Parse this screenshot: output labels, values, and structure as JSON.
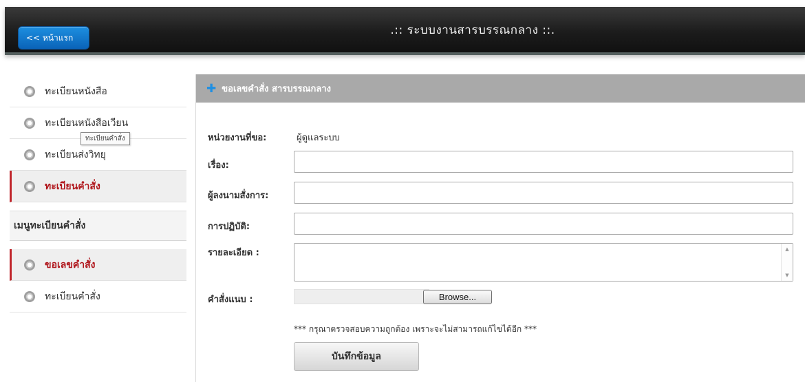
{
  "header": {
    "home_label": "<< หน้าแรก",
    "title": ".:: ระบบงานสารบรรณกลาง ::."
  },
  "sidebar": {
    "top_items": [
      {
        "label": "ทะเบียนหนังสือ",
        "active": false
      },
      {
        "label": "ทะเบียนหนังสือเวียน",
        "active": false
      },
      {
        "label": "ทะเบียนส่งวิทยุ",
        "active": false
      },
      {
        "label": "ทะเบียนคำสั่ง",
        "active": true
      }
    ],
    "tooltip": "ทะเบียนคำสั่ง",
    "submenu_header": "เมนูทะเบียนคำสั่ง",
    "sub_items": [
      {
        "label": "ขอเลขคำสั่ง",
        "active": true
      },
      {
        "label": "ทะเบียนคำสั่ง",
        "active": false
      }
    ]
  },
  "form": {
    "panel_title": "ขอเลขคำสั่ง สารบรรณกลาง",
    "requester_label": "หน่วยงานที่ขอ:",
    "requester_value": "ผู้ดูแลระบบ",
    "subject_label": "เรื่อง:",
    "subject_value": "",
    "signer_label": "ผู้ลงนามสั่งการ:",
    "signer_value": "",
    "action_label": "การปฏิบัติ:",
    "action_value": "",
    "detail_label": "รายละเอียด :",
    "attach_label": "คำสั่งแนบ :",
    "browse_label": "Browse...",
    "warning": "*** กรุณาตรวจสอบความถูกต้อง เพราะจะไม่สามารถแก้ไขได้อีก ***",
    "save_label": "บันทึกข้อมูล"
  },
  "colors": {
    "accent_blue": "#0a63b8",
    "active_red": "#c0262c",
    "panel_grey": "#a9a9a9"
  }
}
